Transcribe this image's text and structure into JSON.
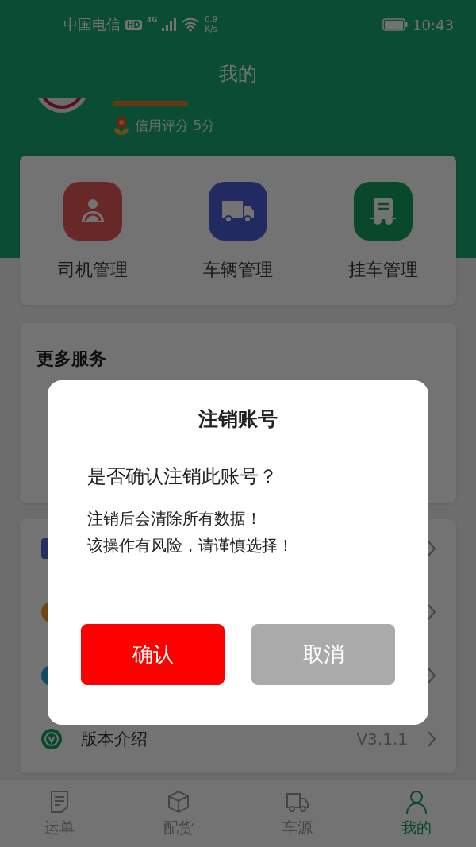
{
  "status_bar": {
    "carrier": "中国电信",
    "hd": "HD",
    "network": "4G",
    "speed_value": "0.9",
    "speed_unit": "K/s",
    "time": "10:43"
  },
  "header": {
    "title": "我的"
  },
  "profile": {
    "credit": "信用评分 5分"
  },
  "shortcuts": [
    {
      "label": "司机管理",
      "kind": "driver"
    },
    {
      "label": "车辆管理",
      "kind": "truck"
    },
    {
      "label": "挂车管理",
      "kind": "trailer"
    }
  ],
  "more_services": {
    "title": "更多服务"
  },
  "menu": {
    "items": [
      {
        "kind": "square"
      },
      {
        "kind": "orange"
      },
      {
        "kind": "cyan"
      },
      {
        "kind": "version",
        "label": "版本介绍",
        "value": "V3.1.1"
      }
    ]
  },
  "dialog": {
    "title": "注销账号",
    "question": "是否确认注销此账号？",
    "message_lines": [
      "注销后会清除所有数据！",
      "该操作有风险，请谨慎选择！"
    ],
    "buttons": [
      {
        "label": "确认",
        "kind": "confirm"
      },
      {
        "label": "取消",
        "kind": "cancel"
      }
    ]
  },
  "tab_bar": [
    {
      "label": "运单",
      "kind": "doc",
      "selected": false
    },
    {
      "label": "配货",
      "kind": "box",
      "selected": false
    },
    {
      "label": "车源",
      "kind": "truck",
      "selected": false
    },
    {
      "label": "我的",
      "kind": "person",
      "selected": true
    }
  ]
}
